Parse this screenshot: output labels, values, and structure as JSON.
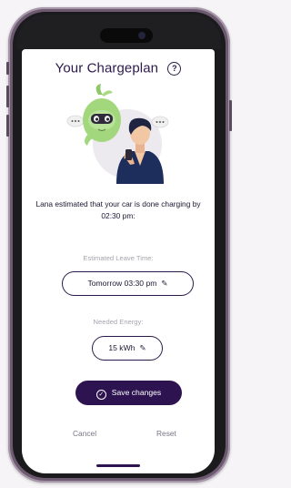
{
  "screen": {
    "title": "Your Chargeplan",
    "help_icon": "question-circle-icon",
    "illustration": "robot-assistant-and-person-with-phone",
    "message": "Lana estimated that your car is done charging by 02:30 pm:",
    "leave_time": {
      "label": "Estimated Leave Time:",
      "value": "Tomorrow 03:30 pm",
      "edit_icon": "pencil-icon"
    },
    "energy": {
      "label": "Needed Energy:",
      "value": "15 kWh",
      "edit_icon": "pencil-icon"
    },
    "save_button": {
      "label": "Save changes",
      "icon": "check-circle-icon"
    },
    "cancel_label": "Cancel",
    "reset_label": "Reset"
  },
  "colors": {
    "brand_dark": "#2d1450",
    "title_text": "#2b1a4a",
    "robot_green": "#9fd47a",
    "muted_text": "#a7a3ad",
    "link_text": "#7a7485",
    "phone_frame": "#6d5a70"
  }
}
